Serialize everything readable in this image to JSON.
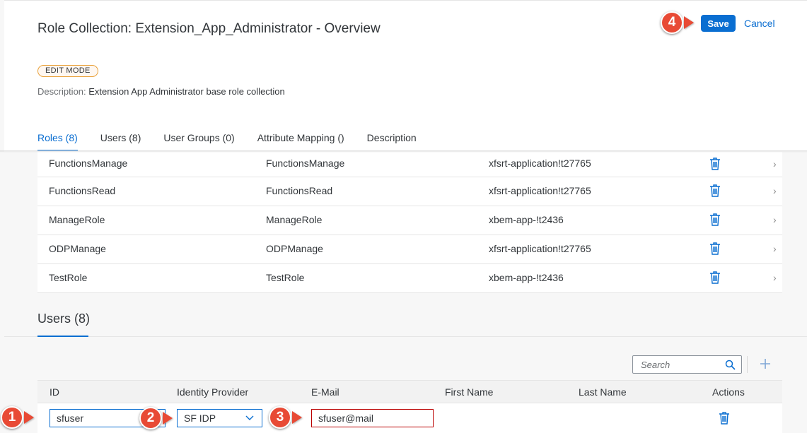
{
  "header": {
    "title": "Role Collection: Extension_App_Administrator - Overview",
    "save_label": "Save",
    "cancel_label": "Cancel",
    "mode_badge": "EDIT MODE",
    "description_label": "Description:",
    "description_value": "Extension App Administrator base role collection"
  },
  "tabs": [
    {
      "label": "Roles (8)",
      "selected": true
    },
    {
      "label": "Users (8)"
    },
    {
      "label": "User Groups (0)"
    },
    {
      "label": "Attribute Mapping ()"
    },
    {
      "label": "Description"
    }
  ],
  "roles": [
    {
      "name": "FunctionsManage",
      "template": "FunctionsManage",
      "app": "xfsrt-application!t27765"
    },
    {
      "name": "FunctionsRead",
      "template": "FunctionsRead",
      "app": "xfsrt-application!t27765"
    },
    {
      "name": "ManageRole",
      "template": "ManageRole",
      "app": "xbem-app-!t2436"
    },
    {
      "name": "ODPManage",
      "template": "ODPManage",
      "app": "xfsrt-application!t27765"
    },
    {
      "name": "TestRole",
      "template": "TestRole",
      "app": "xbem-app-!t2436"
    }
  ],
  "users_section": {
    "title": "Users (8)",
    "search_placeholder": "Search",
    "columns": [
      "ID",
      "Identity Provider",
      "E-Mail",
      "First Name",
      "Last Name",
      "Actions"
    ],
    "new_row": {
      "id": "sfuser",
      "identity_provider": "SF IDP",
      "email": "sfuser@mail"
    }
  },
  "callouts": [
    "1",
    "2",
    "3",
    "4"
  ],
  "colors": {
    "accent": "#0a6ed1",
    "error": "#bb0000",
    "callout": "#e84a35",
    "badge_border": "#e9a23b"
  }
}
